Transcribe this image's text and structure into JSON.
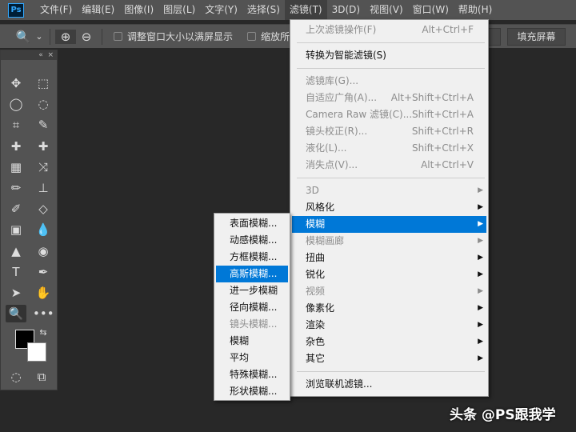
{
  "menubar": {
    "logo": "Ps",
    "items": [
      "文件(F)",
      "编辑(E)",
      "图像(I)",
      "图层(L)",
      "文字(Y)",
      "选择(S)",
      "滤镜(T)",
      "3D(D)",
      "视图(V)",
      "窗口(W)",
      "帮助(H)"
    ],
    "active": "滤镜(T)"
  },
  "options": {
    "tool_icon": "🔍",
    "chevron": "⌄",
    "zoom_in": "⊕",
    "zoom_out": "⊖",
    "check1": "调整窗口大小以满屏显示",
    "check2": "缩放所有窗口",
    "fill_screen": "填充屏幕"
  },
  "toolbox": {
    "collapse": "«",
    "close": "×",
    "tools": [
      [
        "✥",
        "⬚"
      ],
      [
        "◯",
        "◌"
      ],
      [
        "⌗",
        "✎"
      ],
      [
        "✚",
        "✚"
      ],
      [
        "▦",
        "⤨"
      ],
      [
        "✏",
        "⊥"
      ],
      [
        "✐",
        "◇"
      ],
      [
        "▣",
        "💧"
      ],
      [
        "▲",
        "◉"
      ],
      [
        "T",
        "✒"
      ],
      [
        "➤",
        "✋"
      ],
      [
        "🔍",
        "•••"
      ]
    ],
    "swap": "⇆",
    "screen_mode": "◌",
    "frame": "⧉"
  },
  "filter_menu": {
    "items": [
      {
        "label": "上次滤镜操作(F)",
        "shortcut": "Alt+Ctrl+F",
        "disabled": true
      },
      {
        "sep": true
      },
      {
        "label": "转换为智能滤镜(S)"
      },
      {
        "sep": true
      },
      {
        "label": "滤镜库(G)...",
        "disabled": true
      },
      {
        "label": "自适应广角(A)...",
        "shortcut": "Alt+Shift+Ctrl+A",
        "disabled": true
      },
      {
        "label": "Camera Raw 滤镜(C)...",
        "shortcut": "Shift+Ctrl+A",
        "disabled": true
      },
      {
        "label": "镜头校正(R)...",
        "shortcut": "Shift+Ctrl+R",
        "disabled": true
      },
      {
        "label": "液化(L)...",
        "shortcut": "Shift+Ctrl+X",
        "disabled": true
      },
      {
        "label": "消失点(V)...",
        "shortcut": "Alt+Ctrl+V",
        "disabled": true
      },
      {
        "sep": true
      },
      {
        "label": "3D",
        "submenu": true,
        "disabled": true
      },
      {
        "label": "风格化",
        "submenu": true
      },
      {
        "label": "模糊",
        "submenu": true,
        "highlighted": true
      },
      {
        "label": "模糊画廊",
        "submenu": true,
        "disabled": true
      },
      {
        "label": "扭曲",
        "submenu": true
      },
      {
        "label": "锐化",
        "submenu": true
      },
      {
        "label": "视频",
        "submenu": true,
        "disabled": true
      },
      {
        "label": "像素化",
        "submenu": true
      },
      {
        "label": "渲染",
        "submenu": true
      },
      {
        "label": "杂色",
        "submenu": true
      },
      {
        "label": "其它",
        "submenu": true
      },
      {
        "sep": true
      },
      {
        "label": "浏览联机滤镜..."
      }
    ]
  },
  "blur_submenu": {
    "items": [
      {
        "label": "表面模糊..."
      },
      {
        "label": "动感模糊..."
      },
      {
        "label": "方框模糊..."
      },
      {
        "label": "高斯模糊...",
        "highlighted": true
      },
      {
        "label": "进一步模糊"
      },
      {
        "label": "径向模糊..."
      },
      {
        "label": "镜头模糊...",
        "disabled": true
      },
      {
        "label": "模糊"
      },
      {
        "label": "平均"
      },
      {
        "label": "特殊模糊..."
      },
      {
        "label": "形状模糊..."
      }
    ]
  },
  "watermark": "头条 @PS跟我学",
  "colors": {
    "highlight": "#0078d7",
    "menu_bg": "#f0f0f0",
    "ui_bg": "#535353",
    "canvas": "#282828"
  }
}
